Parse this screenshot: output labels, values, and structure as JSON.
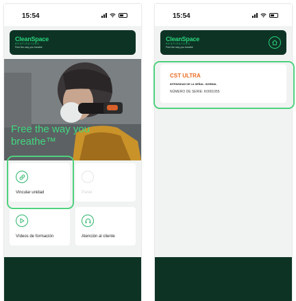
{
  "left": {
    "time": "15:54",
    "brand": {
      "name": "CleanSpace",
      "sub": "RESPIRATORS",
      "tag": "Free the way you breathe"
    },
    "hero": {
      "tagline": "Free the way you breathe™"
    },
    "tiles": [
      {
        "label": "Vincular unidad",
        "icon": "link-icon",
        "enabled": true
      },
      {
        "label": "Panel",
        "icon": "gauge-icon",
        "enabled": false
      },
      {
        "label": "Vídeos de formación",
        "icon": "play-icon",
        "enabled": true
      },
      {
        "label": "Atención al cliente",
        "icon": "headset-icon",
        "enabled": true
      }
    ]
  },
  "right": {
    "time": "15:54",
    "brand": {
      "name": "CleanSpace",
      "sub": "RESPIRATORS",
      "tag": "Free the way you breathe"
    },
    "device": {
      "name": "CST ULTRA",
      "signal": "INTENSIDAD DE LA SEÑAL: NORMAL",
      "serial": "NÚMERO DE SERIE: K0001055"
    }
  },
  "colors": {
    "brand_dark": "#0d3325",
    "brand_green": "#2ad27a",
    "highlight": "#4fd07e",
    "device_accent": "#e86a1f"
  }
}
